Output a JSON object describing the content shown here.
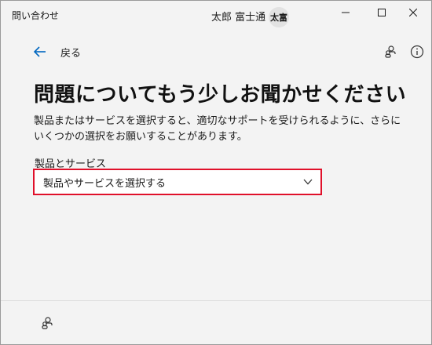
{
  "window": {
    "title": "問い合わせ",
    "user_name": "太郎 富士通",
    "avatar_initials": "太富"
  },
  "nav": {
    "back_label": "戻る"
  },
  "main": {
    "heading": "問題についてもう少しお聞かせください",
    "description": "製品またはサービスを選択すると、適切なサポートを受けられるように、さらにいくつかの選択をお願いすることがあります。",
    "field_label": "製品とサービス",
    "select_value": "製品やサービスを選択する"
  },
  "colors": {
    "accent": "#0067c0",
    "highlight_border": "#e0102a"
  },
  "icons": [
    "back-arrow-icon",
    "share-icon",
    "info-icon",
    "chevron-down-icon",
    "minimize-icon",
    "maximize-icon",
    "close-icon"
  ]
}
